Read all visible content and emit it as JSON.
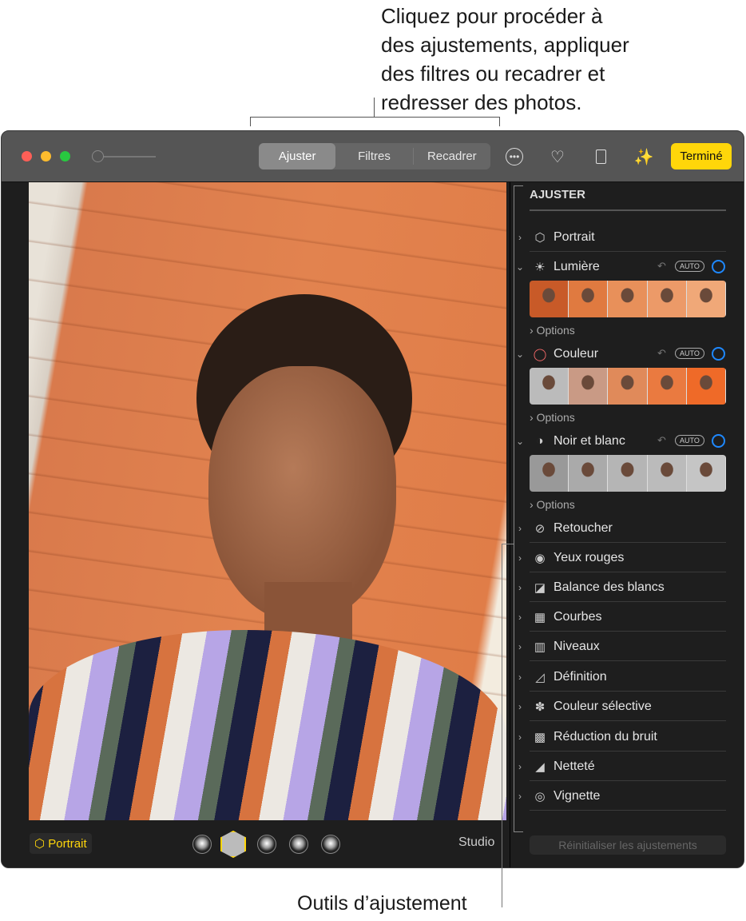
{
  "callouts": {
    "top": [
      "Cliquez pour procéder à",
      "des ajustements, appliquer",
      "des filtres ou recadrer et",
      "redresser des photos."
    ],
    "bottom": "Outils d’ajustement"
  },
  "toolbar": {
    "tabs": [
      "Ajuster",
      "Filtres",
      "Recadrer"
    ],
    "active_tab": "Ajuster",
    "done": "Terminé",
    "icons": [
      "more-icon",
      "heart-icon",
      "rotate-icon",
      "magic-wand-icon"
    ]
  },
  "sidebar": {
    "title": "AJUSTER",
    "auto": "AUTO",
    "options": "Options",
    "items": [
      {
        "label": "Portrait",
        "icon": "cube"
      },
      {
        "label": "Lumière",
        "icon": "sun"
      },
      {
        "label": "Couleur",
        "icon": "color-ring"
      },
      {
        "label": "Noir et blanc",
        "icon": "half-circle"
      },
      {
        "label": "Retoucher",
        "icon": "bandage"
      },
      {
        "label": "Yeux rouges",
        "icon": "eye"
      },
      {
        "label": "Balance des blancs",
        "icon": "white-balance"
      },
      {
        "label": "Courbes",
        "icon": "curves"
      },
      {
        "label": "Niveaux",
        "icon": "levels"
      },
      {
        "label": "Définition",
        "icon": "triangle"
      },
      {
        "label": "Couleur sélective",
        "icon": "dots"
      },
      {
        "label": "Réduction du bruit",
        "icon": "noise"
      },
      {
        "label": "Netteté",
        "icon": "sharpen"
      },
      {
        "label": "Vignette",
        "icon": "vignette"
      }
    ],
    "reset": "Réinitialiser les ajustements"
  },
  "bottom": {
    "portrait": "Portrait",
    "lighting": "Studio"
  },
  "colors": {
    "accent": "#ffd60a",
    "ring": "#1e88ff"
  }
}
